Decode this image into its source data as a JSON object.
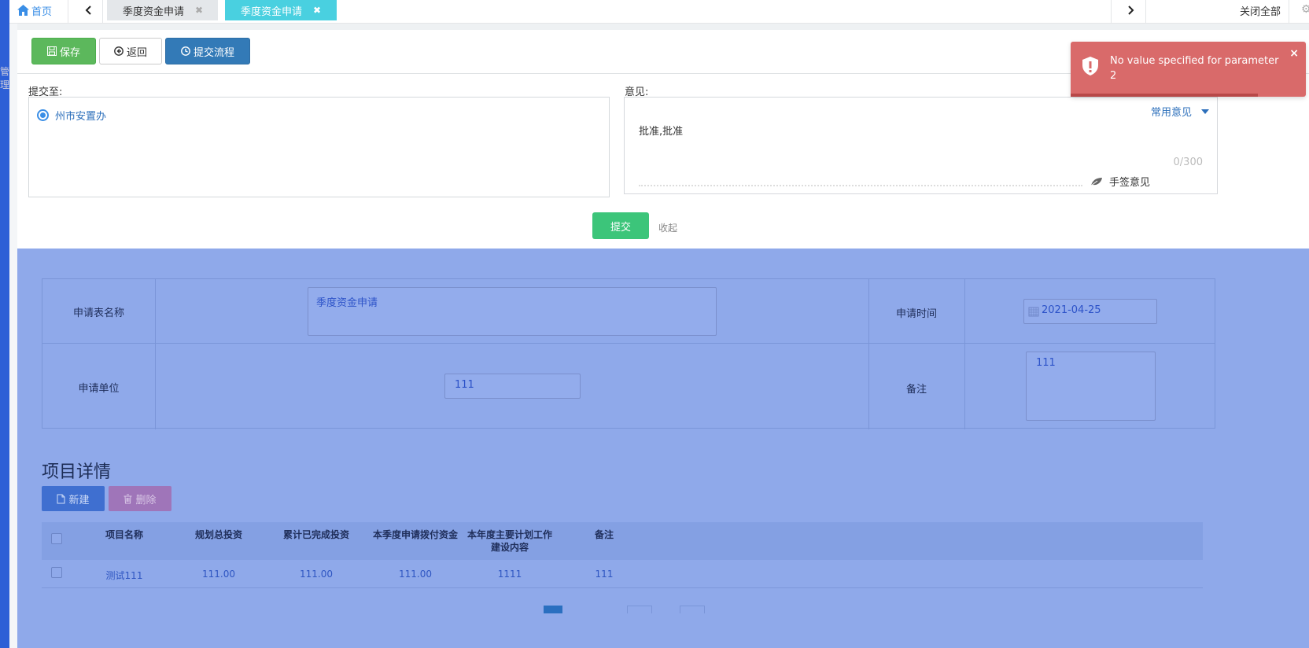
{
  "sidebar": {
    "edge_text": "管理"
  },
  "tabbar": {
    "home_label": "首页",
    "tabs": [
      {
        "label": "季度资金申请",
        "close": "✖",
        "active": false
      },
      {
        "label": "季度资金申请",
        "close": "✖",
        "active": true
      }
    ],
    "close_all_label": "关闭全部",
    "prev_icon": "chevron-left-icon",
    "next_icon": "chevron-right-icon"
  },
  "toolbar": {
    "save_label": "保存",
    "back_label": "返回",
    "submit_flow_label": "提交流程"
  },
  "workflow": {
    "submit_to_label": "提交至:",
    "selected_target": "州市安置办",
    "opinion_label": "意见:",
    "common_opinion_label": "常用意见",
    "opinion_text": "批准,批准",
    "char_count": "0/300",
    "handsign_label": "手签意见",
    "submit_label": "提交",
    "collapse_label": "收起"
  },
  "form": {
    "name_label": "申请表名称",
    "name_value": "季度资金申请",
    "time_label": "申请时间",
    "time_value": "2021-04-25",
    "unit_label": "申请单位",
    "unit_value": "111",
    "remark_label": "备注",
    "remark_value": "111"
  },
  "details": {
    "title": "项目详情",
    "new_label": "新建",
    "delete_label": "删除",
    "columns": {
      "name": "项目名称",
      "planned": "规划总投资",
      "completed": "累计已完成投资",
      "quarter": "本季度申请拨付资金",
      "content_line1": "本年度主要计划工作",
      "content_line2": "建设内容",
      "remark": "备注"
    },
    "rows": [
      {
        "name": "测试111",
        "planned": "111.00",
        "completed": "111.00",
        "quarter": "111.00",
        "content": "1111",
        "remark": "111"
      }
    ]
  },
  "toast": {
    "message": "No value specified for parameter 2",
    "close": "×",
    "color": "#d96a6a"
  }
}
